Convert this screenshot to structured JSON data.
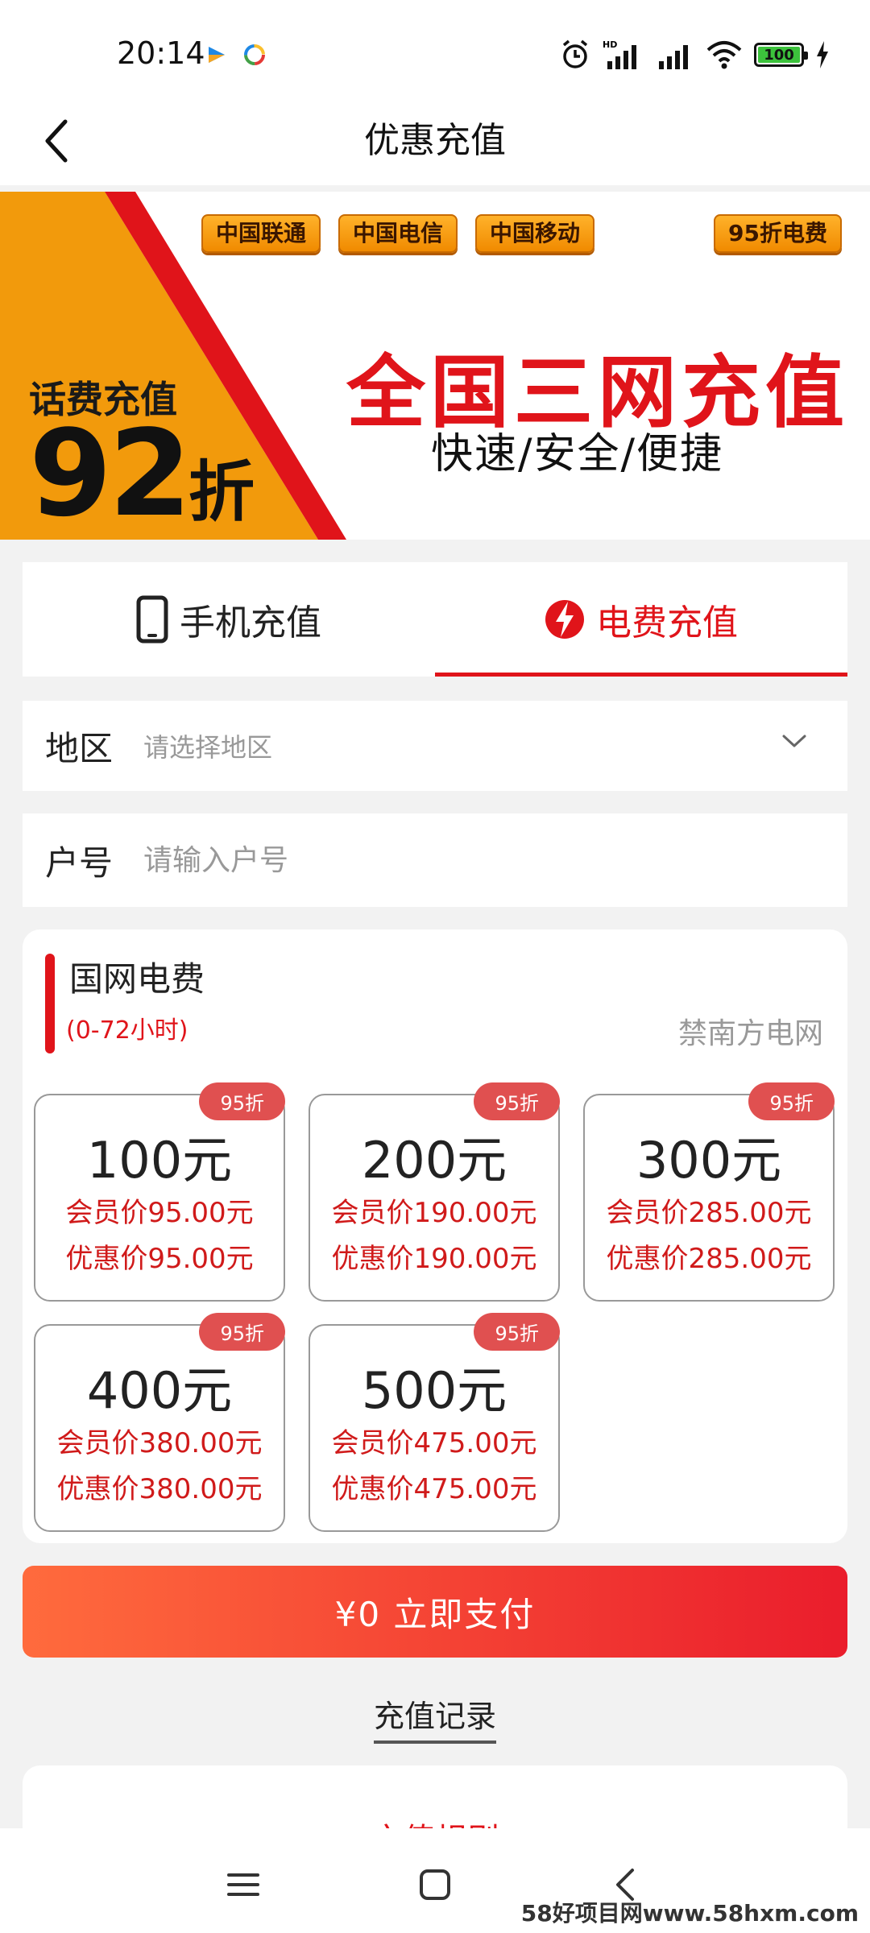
{
  "status_bar": {
    "time": "20:14",
    "battery": "100",
    "icons": [
      "alarm-icon",
      "hd-signal-icon",
      "signal-icon",
      "wifi-icon",
      "battery-icon",
      "charging-icon"
    ]
  },
  "header": {
    "title": "优惠充值",
    "back_icon": "back-arrow-icon"
  },
  "banner": {
    "carriers": [
      "中国联通",
      "中国电信",
      "中国移动"
    ],
    "badge": "95折电费",
    "left_title": "话费充值",
    "discount_number": "92",
    "discount_unit": "折",
    "headline": "全国三网充值",
    "subline": "快速/安全/便捷",
    "colors": {
      "orange": "#f29a0c",
      "red": "#e0141a"
    }
  },
  "tabs": [
    {
      "label": "手机充值",
      "icon": "phone-icon",
      "active": false
    },
    {
      "label": "电费充值",
      "icon": "lightning-icon",
      "active": true
    }
  ],
  "form": {
    "region": {
      "label": "地区",
      "placeholder": "请选择地区"
    },
    "account": {
      "label": "户号",
      "placeholder": "请输入户号"
    }
  },
  "product": {
    "title": "国网电费",
    "subtitle": "(0-72小时)",
    "grid_name": "禁南方电网",
    "options": [
      {
        "tag": "95折",
        "amount": "100元",
        "member": "会员价95.00元",
        "promo": "优惠价95.00元"
      },
      {
        "tag": "95折",
        "amount": "200元",
        "member": "会员价190.00元",
        "promo": "优惠价190.00元"
      },
      {
        "tag": "95折",
        "amount": "300元",
        "member": "会员价285.00元",
        "promo": "优惠价285.00元"
      },
      {
        "tag": "95折",
        "amount": "400元",
        "member": "会员价380.00元",
        "promo": "优惠价380.00元"
      },
      {
        "tag": "95折",
        "amount": "500元",
        "member": "会员价475.00元",
        "promo": "优惠价475.00元"
      }
    ]
  },
  "pay_button": "¥0 立即支付",
  "history_link": "充值记录",
  "bottom_peek": "充值规则",
  "nav": {
    "icons": [
      "menu-icon",
      "home-icon",
      "back-icon"
    ]
  },
  "watermark": "58好项目网www.58hxm.com",
  "accent_color": "#e0141a"
}
